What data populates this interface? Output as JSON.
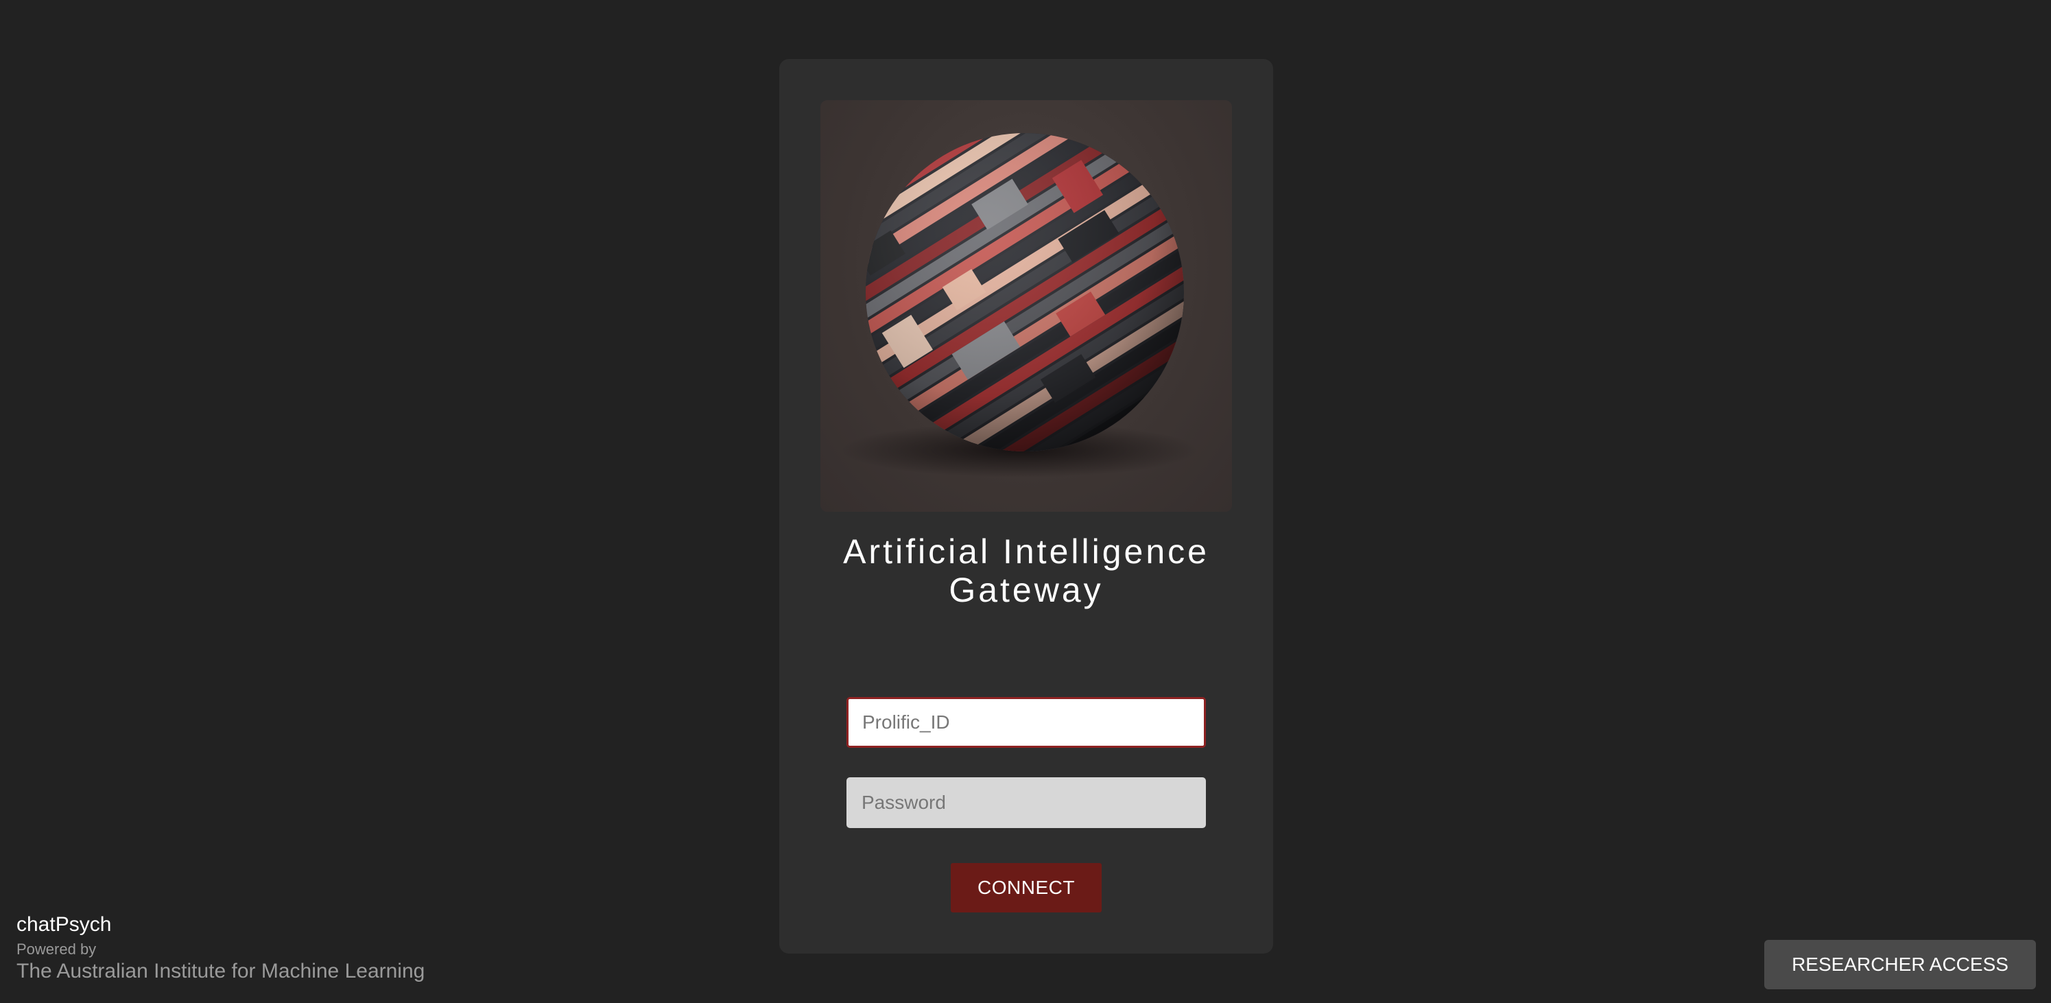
{
  "app": {
    "title": "Artificial Intelligence Gateway"
  },
  "login": {
    "id_placeholder": "Prolific_ID",
    "password_placeholder": "Password",
    "connect_label": "CONNECT"
  },
  "footer": {
    "brand_name": "chatPsych",
    "powered_by": "Powered by",
    "organization": "The Australian Institute for Machine Learning",
    "researcher_access_label": "RESEARCHER ACCESS"
  },
  "colors": {
    "background": "#222222",
    "card": "#2e2e2e",
    "accent": "#6b1b17",
    "input_border_active": "#8e2222"
  },
  "icons": {
    "hero": "striped-sphere-image"
  }
}
